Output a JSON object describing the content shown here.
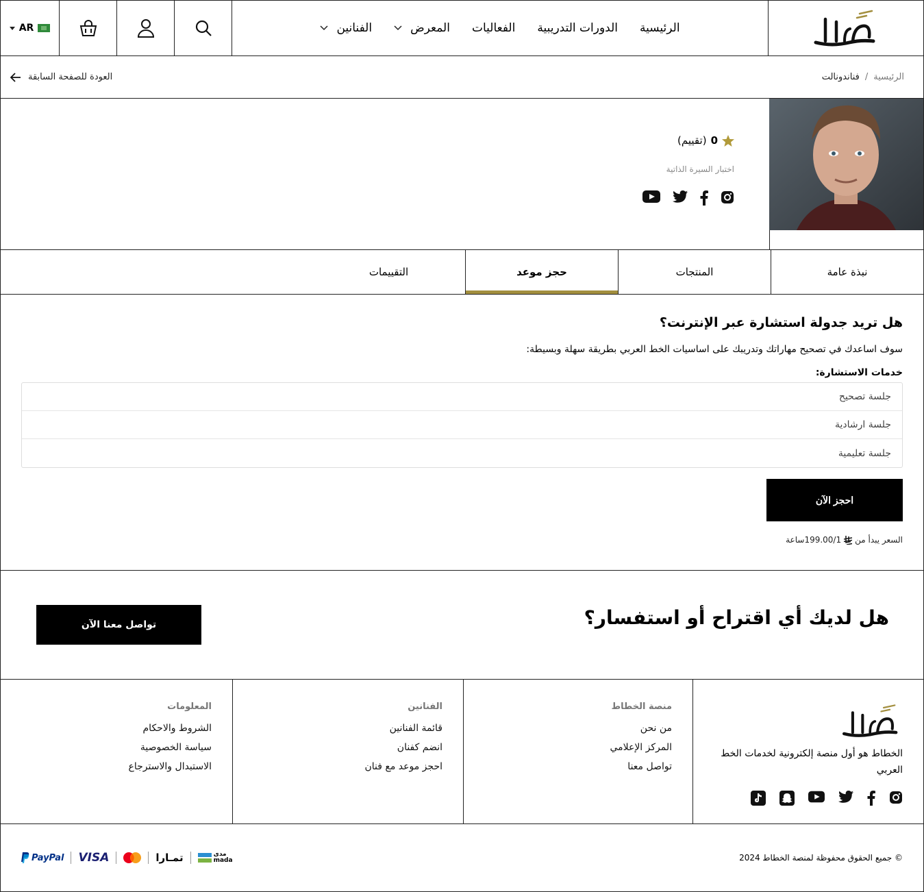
{
  "header": {
    "lang": "AR",
    "nav": [
      "الرئيسية",
      "الدورات التدريبية",
      "الفعاليات",
      "المعرض",
      "الفنانين"
    ]
  },
  "crumbs": {
    "home": "الرئيسية",
    "sep": "/",
    "current": "فناندونالت",
    "back": "العودة للصفحة السابقة"
  },
  "profile": {
    "rating_count": "0",
    "rating_label": "(تقييم)",
    "bio": "اختبار السيرة الذاتية"
  },
  "tabs": [
    "نبذة عامة",
    "المنتجات",
    "حجز موعد",
    "التقييمات"
  ],
  "booking": {
    "title": "هل تريد جدولة استشارة عبر الإنترنت؟",
    "desc": "سوف اساعدك في تصحيح مهاراتك وتدريبك على اساسيات الخط العربي بطريقة سهلة وبسيطة:",
    "services_title": "خدمات الاستشارة:",
    "services": [
      "جلسة تصحيح",
      "جلسة ارشادية",
      "جلسة تعليمية"
    ],
    "button": "احجز الآن",
    "price_prefix": "السعر يبدأ من",
    "price_value": "199.00/1ساعة"
  },
  "cta": {
    "title": "هل لديك أي اقتراح أو استفسار؟",
    "button": "تواصل معنا الآن"
  },
  "footer": {
    "tagline": "الخطاط هو أول منصة إلكترونية لخدمات الخط العربي",
    "col1": {
      "title": "منصة الخطاط",
      "links": [
        "من نحن",
        "المركز الإعلامي",
        "تواصل معنا"
      ]
    },
    "col2": {
      "title": "الفنانين",
      "links": [
        "قائمة الفنانين",
        "انضم كفنان",
        "احجز موعد مع فنان"
      ]
    },
    "col3": {
      "title": "المعلومات",
      "links": [
        "الشروط والاحكام",
        "سياسة الخصوصية",
        "الاستبدال والاسترجاع"
      ]
    },
    "copyright": "© جميع الحقوق محفوظة لمنصة الخطاط 2024",
    "payments": {
      "mada_ar": "مدى",
      "mada_en": "mada",
      "tamara": "تمـارا",
      "visa": "VISA",
      "paypal": "PayPal"
    }
  },
  "colors": {
    "accent": "#a38f3f",
    "star": "#b19a3a",
    "dark": "#000000"
  }
}
